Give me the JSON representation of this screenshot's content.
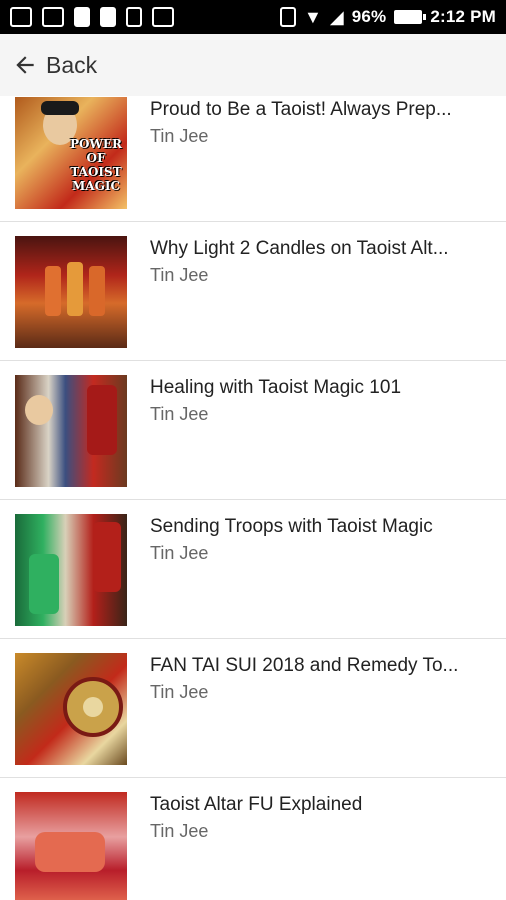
{
  "status_bar": {
    "battery": "96%",
    "time": "2:12 PM"
  },
  "app_bar": {
    "back_label": "Back"
  },
  "videos": [
    {
      "title": "Proud to Be a Taoist! Always Prep...",
      "author": "Tin Jee",
      "thumb_caption": "POWER OF TAOIST MAGIC"
    },
    {
      "title": "Why Light 2 Candles on Taoist Alt...",
      "author": "Tin Jee"
    },
    {
      "title": "Healing with Taoist Magic 101",
      "author": "Tin Jee"
    },
    {
      "title": "Sending Troops with Taoist Magic",
      "author": "Tin Jee"
    },
    {
      "title": "FAN TAI SUI 2018 and Remedy To...",
      "author": "Tin Jee"
    },
    {
      "title": "Taoist Altar FU Explained",
      "author": "Tin Jee"
    }
  ]
}
